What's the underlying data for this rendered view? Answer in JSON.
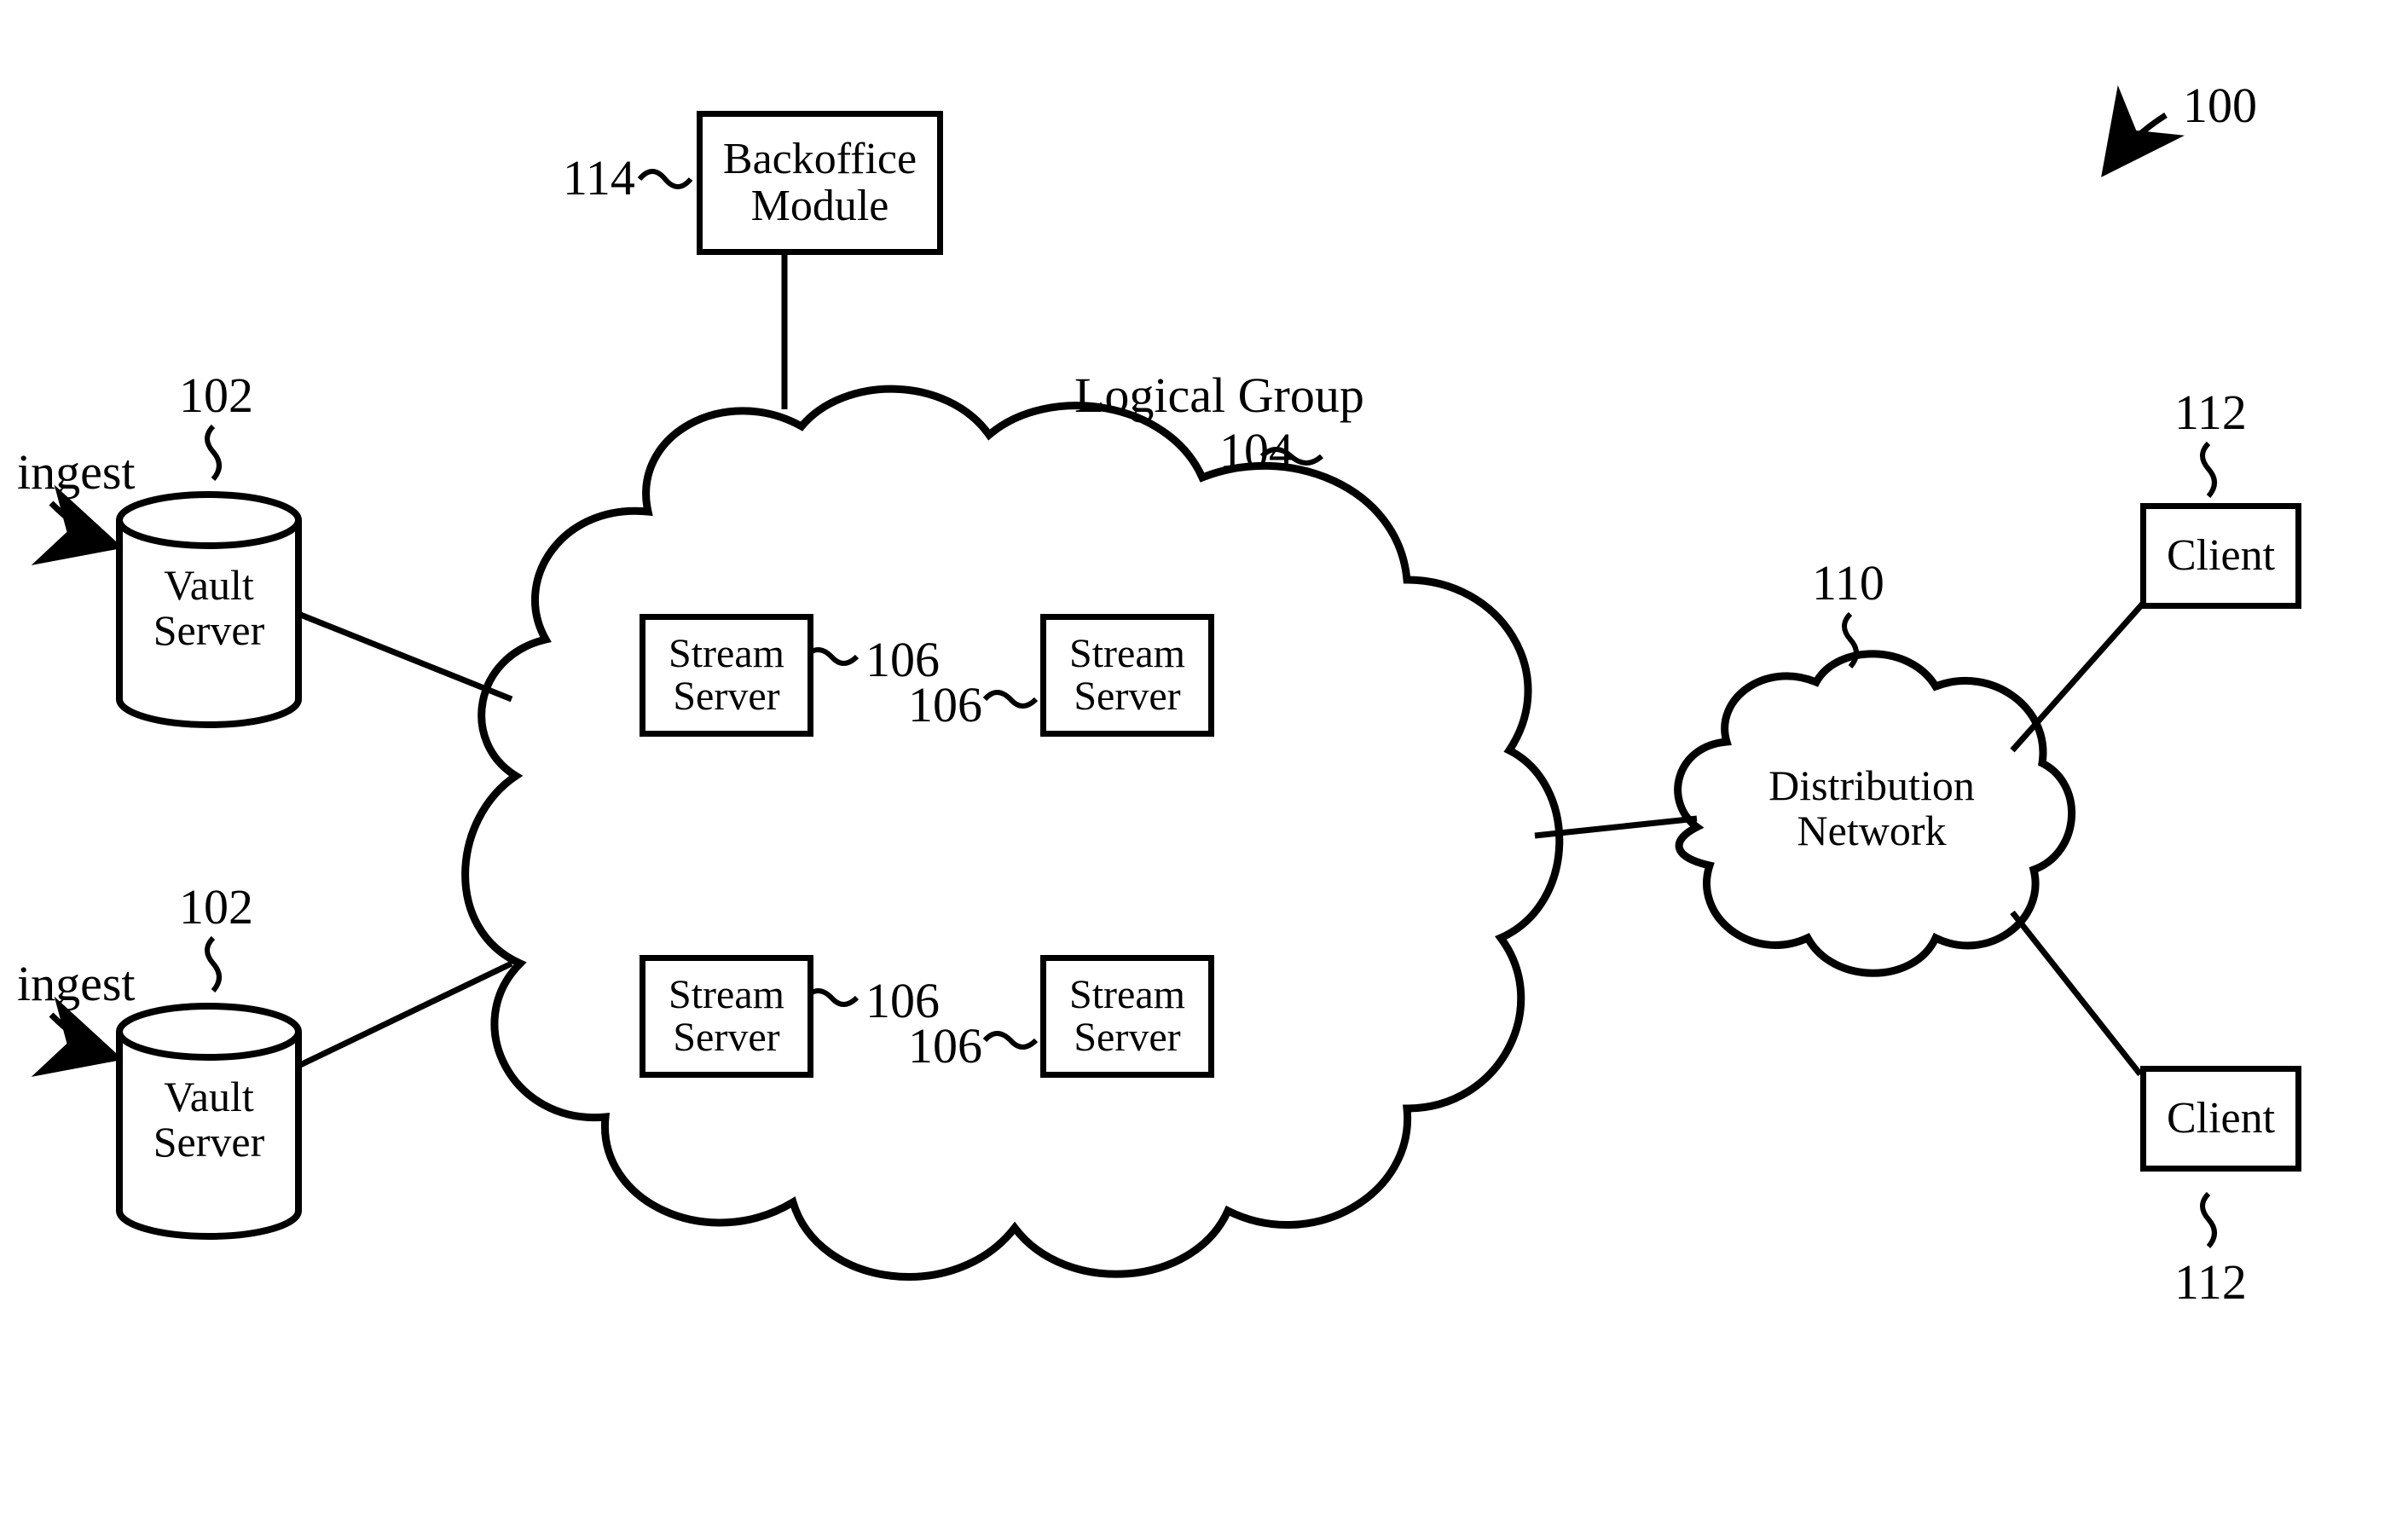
{
  "refs": {
    "system": "100",
    "vault": "102",
    "logical_group": "104",
    "stream": "106",
    "dist": "110",
    "client": "112",
    "backoffice": "114"
  },
  "labels": {
    "ingest": "ingest",
    "vault_server_l1": "Vault",
    "vault_server_l2": "Server",
    "stream_l1": "Stream",
    "stream_l2": "Server",
    "backoffice_l1": "Backoffice",
    "backoffice_l2": "Module",
    "logical_group": "Logical Group",
    "dist_l1": "Distribution",
    "dist_l2": "Network",
    "client": "Client"
  }
}
